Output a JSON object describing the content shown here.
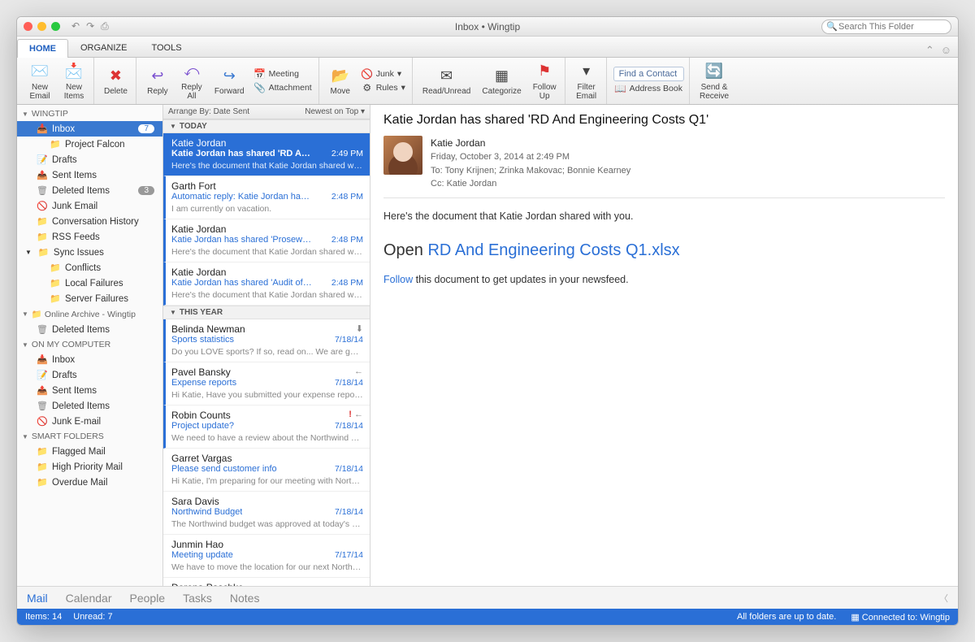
{
  "window": {
    "title": "Inbox • Wingtip",
    "search_placeholder": "Search This Folder"
  },
  "tabs": {
    "items": [
      "HOME",
      "ORGANIZE",
      "TOOLS"
    ],
    "active": 0
  },
  "ribbon": {
    "new_email": "New\nEmail",
    "new_items": "New\nItems",
    "delete": "Delete",
    "reply": "Reply",
    "reply_all": "Reply\nAll",
    "forward": "Forward",
    "meeting": "Meeting",
    "attachment": "Attachment",
    "move": "Move",
    "junk": "Junk",
    "rules": "Rules",
    "read_unread": "Read/Unread",
    "categorize": "Categorize",
    "follow_up": "Follow\nUp",
    "filter_email": "Filter\nEmail",
    "find_contact": "Find a Contact",
    "address_book": "Address Book",
    "send_receive": "Send &\nReceive"
  },
  "sidebar": {
    "sections": [
      {
        "title": "WINGTIP",
        "items": [
          {
            "label": "Inbox",
            "icon": "inbox",
            "badge": "7",
            "selected": true,
            "depth": 1
          },
          {
            "label": "Project Falcon",
            "icon": "folder",
            "depth": 2
          },
          {
            "label": "Drafts",
            "icon": "draft",
            "depth": 1
          },
          {
            "label": "Sent Items",
            "icon": "sent",
            "depth": 1
          },
          {
            "label": "Deleted Items",
            "icon": "trash",
            "badge": "3",
            "depth": 1
          },
          {
            "label": "Junk Email",
            "icon": "block",
            "depth": 1
          },
          {
            "label": "Conversation History",
            "icon": "folder",
            "depth": 1
          },
          {
            "label": "RSS Feeds",
            "icon": "folder",
            "depth": 1
          },
          {
            "label": "Sync Issues",
            "icon": "folder",
            "depth": 1,
            "expandable": true
          },
          {
            "label": "Conflicts",
            "icon": "folder",
            "depth": 2
          },
          {
            "label": "Local Failures",
            "icon": "folder",
            "depth": 2
          },
          {
            "label": "Server Failures",
            "icon": "folder",
            "depth": 2
          }
        ]
      },
      {
        "title": "Online Archive - Wingtip",
        "items": [
          {
            "label": "Deleted Items",
            "icon": "trash",
            "depth": 1
          }
        ]
      },
      {
        "title": "ON MY COMPUTER",
        "items": [
          {
            "label": "Inbox",
            "icon": "inbox",
            "depth": 1
          },
          {
            "label": "Drafts",
            "icon": "draft",
            "depth": 1
          },
          {
            "label": "Sent Items",
            "icon": "sent",
            "depth": 1
          },
          {
            "label": "Deleted Items",
            "icon": "trash",
            "depth": 1
          },
          {
            "label": "Junk E-mail",
            "icon": "block",
            "depth": 1
          }
        ]
      },
      {
        "title": "SMART FOLDERS",
        "items": [
          {
            "label": "Flagged Mail",
            "icon": "folder",
            "depth": 1
          },
          {
            "label": "High Priority Mail",
            "icon": "folder",
            "depth": 1
          },
          {
            "label": "Overdue Mail",
            "icon": "folder",
            "depth": 1
          }
        ]
      }
    ]
  },
  "list": {
    "arrange_by": "Arrange By: Date Sent",
    "sort": "Newest on Top",
    "groups": [
      {
        "title": "TODAY",
        "messages": [
          {
            "from": "Katie Jordan",
            "subject": "Katie Jordan has shared 'RD And Engineeri...",
            "time": "2:49 PM",
            "preview": "Here's the document that Katie Jordan shared with you...",
            "unread": true,
            "selected": true
          },
          {
            "from": "Garth Fort",
            "subject": "Automatic reply: Katie Jordan has shared '...",
            "time": "2:48 PM",
            "preview": "I am currently on vacation.",
            "unread": true
          },
          {
            "from": "Katie Jordan",
            "subject": "Katie Jordan has shared 'Proseware Projec...",
            "time": "2:48 PM",
            "preview": "Here's the document that Katie Jordan shared with you...",
            "unread": true
          },
          {
            "from": "Katie Jordan",
            "subject": "Katie Jordan has shared 'Audit of Small Bu...",
            "time": "2:48 PM",
            "preview": "Here's the document that Katie Jordan shared with you...",
            "unread": true
          }
        ]
      },
      {
        "title": "THIS YEAR",
        "messages": [
          {
            "from": "Belinda Newman",
            "subject": "Sports statistics",
            "time": "7/18/14",
            "preview": "Do you LOVE sports? If so, read on... We are going to...",
            "unread": true,
            "flag": "down"
          },
          {
            "from": "Pavel Bansky",
            "subject": "Expense reports",
            "time": "7/18/14",
            "preview": "Hi Katie, Have you submitted your expense reports yet...",
            "unread": true,
            "flag": "replied"
          },
          {
            "from": "Robin Counts",
            "subject": "Project update?",
            "time": "7/18/14",
            "preview": "We need to have a review about the Northwind Traders f...",
            "unread": true,
            "flag": "priority_replied"
          },
          {
            "from": "Garret Vargas",
            "subject": "Please send customer info",
            "time": "7/18/14",
            "preview": "Hi Katie, I'm preparing for our meeting with Northwind,..."
          },
          {
            "from": "Sara Davis",
            "subject": "Northwind Budget",
            "time": "7/18/14",
            "preview": "The Northwind budget was approved at today's board..."
          },
          {
            "from": "Junmin Hao",
            "subject": "Meeting update",
            "time": "7/17/14",
            "preview": "We have to move the location for our next Northwind Tr..."
          },
          {
            "from": "Dorena Paschke",
            "subject": "",
            "time": "",
            "preview": ""
          }
        ]
      }
    ]
  },
  "reading": {
    "subject": "Katie Jordan has shared 'RD And Engineering Costs Q1'",
    "sender": "Katie Jordan",
    "date": "Friday, October 3, 2014 at 2:49 PM",
    "to_label": "To:",
    "to": "Tony Krijnen;   Zrinka Makovac;   Bonnie Kearney",
    "cc_label": "Cc:",
    "cc": "Katie Jordan",
    "line1": "Here's the document that Katie Jordan shared with you.",
    "open_word": "Open ",
    "open_link": "RD And Engineering Costs Q1.xlsx",
    "follow_word": "Follow",
    "follow_rest": " this document to get updates in your newsfeed."
  },
  "nav": {
    "items": [
      "Mail",
      "Calendar",
      "People",
      "Tasks",
      "Notes"
    ],
    "active": 0
  },
  "status": {
    "left_items": "Items: 14",
    "left_unread": "Unread: 7",
    "right1": "All folders are up to date.",
    "right2": "Connected to: Wingtip"
  }
}
